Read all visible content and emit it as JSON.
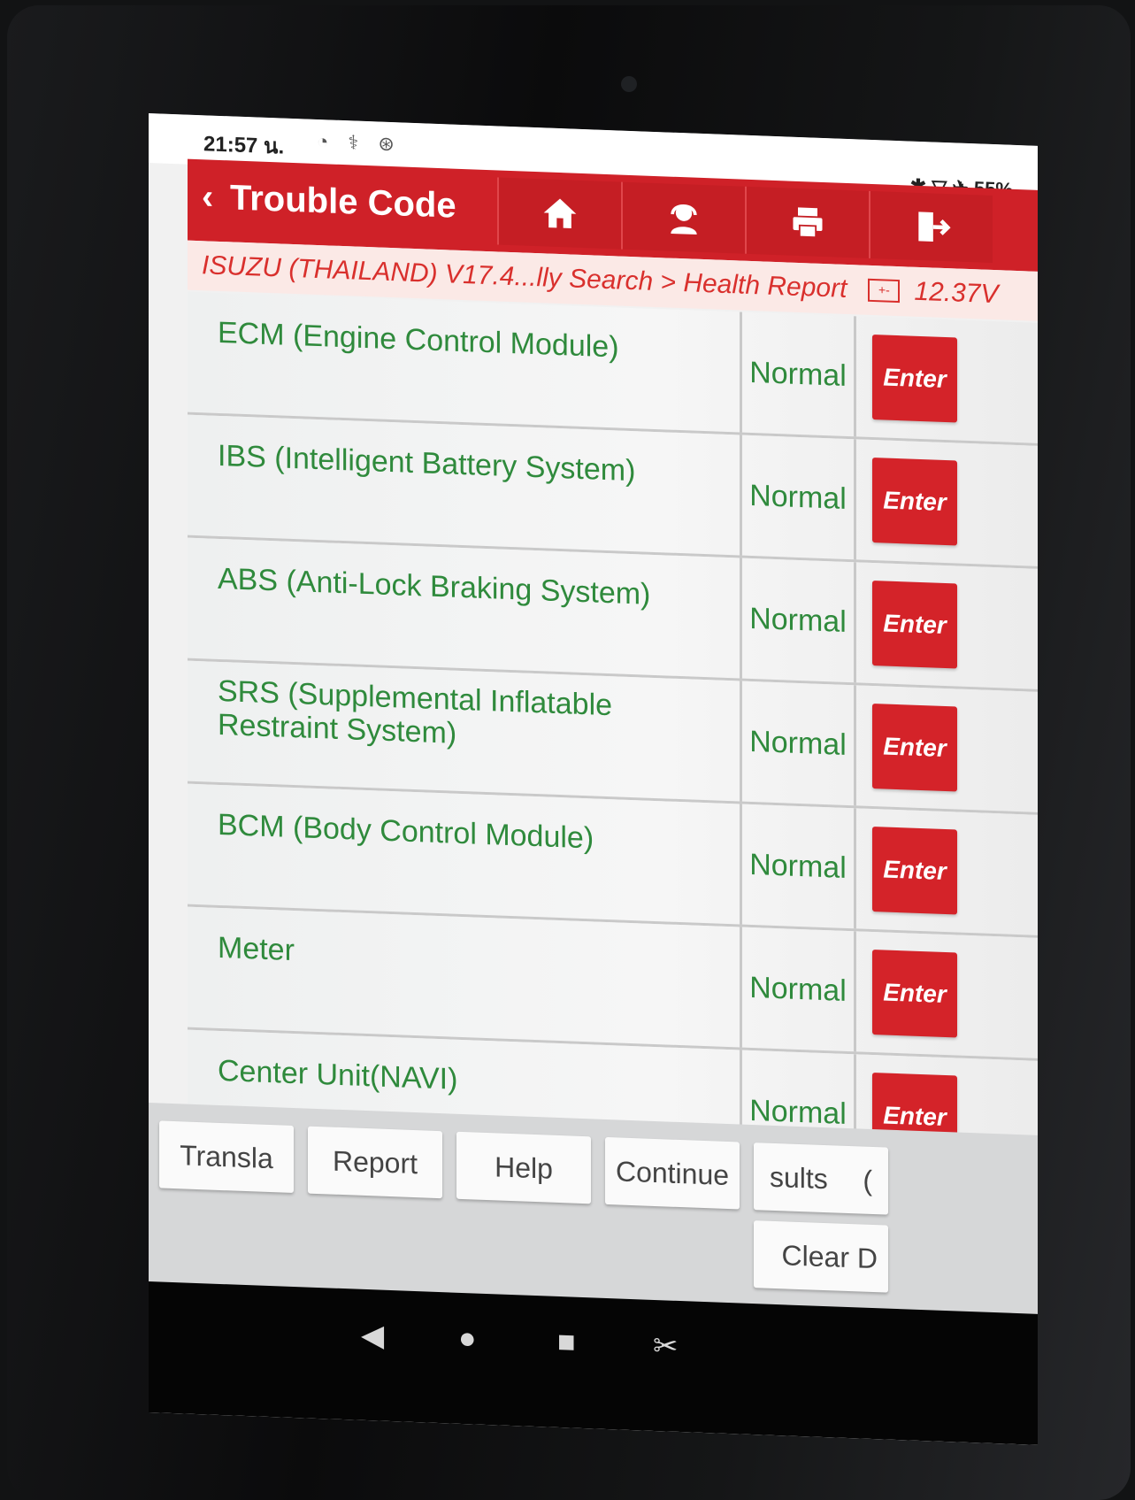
{
  "status_bar": {
    "time": "21:57 น.",
    "battery": "55%"
  },
  "header": {
    "title": "Trouble Code",
    "buttons": [
      "home-icon",
      "support-icon",
      "printer-icon",
      "exit-icon"
    ]
  },
  "breadcrumb": {
    "path": "ISUZU (THAILAND) V17.4...lly Search > Health Report",
    "voltage": "12.37V"
  },
  "systems": [
    {
      "name": "ECM (Engine Control Module)",
      "status": "Normal",
      "action": "Enter"
    },
    {
      "name": "IBS (Intelligent Battery System)",
      "status": "Normal",
      "action": "Enter"
    },
    {
      "name": "ABS (Anti-Lock Braking System)",
      "status": "Normal",
      "action": "Enter"
    },
    {
      "name": "SRS (Supplemental Inflatable Restraint System)",
      "status": "Normal",
      "action": "Enter"
    },
    {
      "name": "BCM (Body Control Module)",
      "status": "Normal",
      "action": "Enter"
    },
    {
      "name": "Meter",
      "status": "Normal",
      "action": "Enter"
    },
    {
      "name": "Center Unit(NAVI)",
      "status": "Normal",
      "action": "Enter"
    }
  ],
  "toolbar": {
    "translate": "Transla",
    "report": "Report",
    "help": "Help",
    "continue": "Continue",
    "results": "sults",
    "results_tail": "(",
    "clear": "Clear D"
  },
  "colors": {
    "header_red": "#cf2128",
    "status_green": "#2f8a3c",
    "enter_red": "#d42329"
  }
}
